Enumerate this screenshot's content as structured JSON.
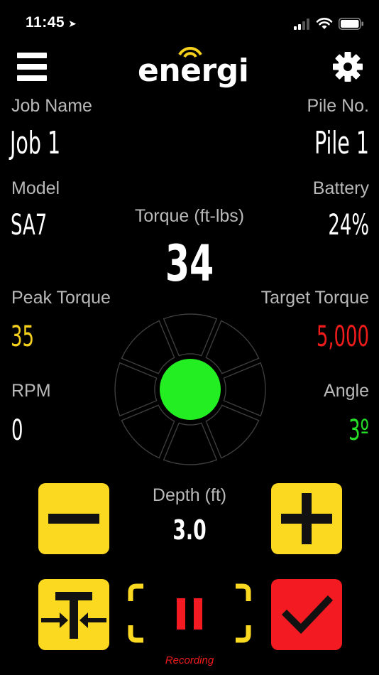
{
  "status_bar": {
    "time": "11:45",
    "location_icon": "location-arrow-icon",
    "signal_icon": "cellular-signal-icon",
    "wifi_icon": "wifi-icon",
    "battery_icon": "battery-icon"
  },
  "header": {
    "menu_icon": "hamburger-menu-icon",
    "logo_text": "energi",
    "settings_icon": "gear-icon"
  },
  "job": {
    "label": "Job Name",
    "value": "Job 1"
  },
  "pile": {
    "label": "Pile No.",
    "value": "Pile 1"
  },
  "model": {
    "label": "Model",
    "value": "SA7"
  },
  "battery": {
    "label": "Battery",
    "value": "24%"
  },
  "torque": {
    "label": "Torque (ft-lbs)",
    "value": "34"
  },
  "peak_torque": {
    "label": "Peak Torque",
    "value": "35",
    "color": "#f5d11d"
  },
  "target_torque": {
    "label": "Target Torque",
    "value": "5,000",
    "color": "#f01b1b"
  },
  "rpm": {
    "label": "RPM",
    "value": "0"
  },
  "angle": {
    "label": "Angle",
    "value": "3º",
    "color": "#27e027"
  },
  "level_indicator": {
    "center_color": "#22ee22",
    "segments": 8
  },
  "depth": {
    "label": "Depth (ft)",
    "value": "3.0"
  },
  "controls": {
    "minus_icon": "minus-icon",
    "plus_icon": "plus-icon",
    "tare_icon": "tare-icon",
    "pause_icon": "pause-icon",
    "check_icon": "checkmark-icon",
    "recording_label": "Recording"
  },
  "colors": {
    "background": "#000000",
    "accent_yellow": "#fcd921",
    "accent_red": "#f31b21",
    "label_gray": "#b9b9b9"
  }
}
